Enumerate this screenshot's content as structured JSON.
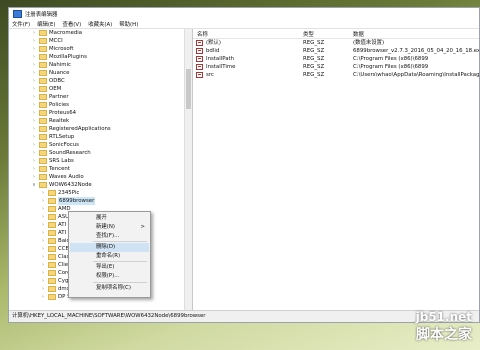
{
  "window": {
    "title": "注册表编辑器",
    "menu": [
      "文件(F)",
      "编辑(E)",
      "查看(V)",
      "收藏夹(A)",
      "帮助(H)"
    ]
  },
  "tree": {
    "items": [
      {
        "label": "Macromedia",
        "level": 1
      },
      {
        "label": "MCCI",
        "level": 1
      },
      {
        "label": "Microsoft",
        "level": 1
      },
      {
        "label": "MozillaPlugins",
        "level": 1
      },
      {
        "label": "Nahimic",
        "level": 1
      },
      {
        "label": "Nuance",
        "level": 1
      },
      {
        "label": "ODBC",
        "level": 1
      },
      {
        "label": "OEM",
        "level": 1
      },
      {
        "label": "Partner",
        "level": 1
      },
      {
        "label": "Policies",
        "level": 1
      },
      {
        "label": "Proteus64",
        "level": 1
      },
      {
        "label": "Realtek",
        "level": 1
      },
      {
        "label": "RegisteredApplications",
        "level": 1
      },
      {
        "label": "RTLSetup",
        "level": 1
      },
      {
        "label": "SonicFocus",
        "level": 1
      },
      {
        "label": "SoundResearch",
        "level": 1
      },
      {
        "label": "SRS Labs",
        "level": 1
      },
      {
        "label": "Tencent",
        "level": 1
      },
      {
        "label": "Waves Audio",
        "level": 1
      },
      {
        "label": "WOW6432Node",
        "level": 1,
        "expanded": true
      },
      {
        "label": "2345Pic",
        "level": 2
      },
      {
        "label": "6899browser",
        "level": 2,
        "selected": true
      },
      {
        "label": "AMD",
        "level": 2
      },
      {
        "label": "ASUS",
        "level": 2
      },
      {
        "label": "ATI",
        "level": 2
      },
      {
        "label": "ATI Techn",
        "level": 2
      },
      {
        "label": "Baidu",
        "level": 2
      },
      {
        "label": "CCB Com",
        "level": 2
      },
      {
        "label": "Classes",
        "level": 2
      },
      {
        "label": "Clients",
        "level": 2
      },
      {
        "label": "CoreCodec",
        "level": 2
      },
      {
        "label": "Cygwin",
        "level": 2
      },
      {
        "label": "dmxtz",
        "level": 2
      },
      {
        "label": "DP Soft",
        "level": 2
      }
    ]
  },
  "values": {
    "headers": {
      "name": "名称",
      "type": "类型",
      "data": "数据"
    },
    "rows": [
      {
        "name": "(默认)",
        "type": "REG_SZ",
        "data": "(数值未设置)"
      },
      {
        "name": "bdlid",
        "type": "REG_SZ",
        "data": "6899browser_v2.7.3_2016_05_04_20_16_18.exe"
      },
      {
        "name": "InstallPath",
        "type": "REG_SZ",
        "data": "C:\\Program Files (x86)\\6899"
      },
      {
        "name": "InstallTime",
        "type": "REG_SZ",
        "data": "C:\\Program Files (x86)\\6899"
      },
      {
        "name": "src",
        "type": "REG_SZ",
        "data": "C:\\Users\\whao\\AppData\\Roaming\\InstallPackage\\6899"
      }
    ]
  },
  "context_menu": {
    "items": [
      {
        "label": "展开"
      },
      {
        "label": "新建(N)",
        "submenu": ">"
      },
      {
        "label": "查找(F)..."
      },
      {
        "label": "删除(D)",
        "highlighted": true
      },
      {
        "label": "重命名(R)"
      },
      {
        "label": "导出(E)"
      },
      {
        "label": "权限(P)..."
      },
      {
        "label": "复制项名称(C)"
      }
    ]
  },
  "statusbar": {
    "path": "计算机\\HKEY_LOCAL_MACHINE\\SOFTWARE\\WOW6432Node\\6899browser"
  },
  "watermark": {
    "url": "jb51.net",
    "name": "脚本之家"
  },
  "colors": {
    "selection": "#cde6f7",
    "menu_highlight": "#cfe3f5",
    "folder": "#f5d77a"
  }
}
